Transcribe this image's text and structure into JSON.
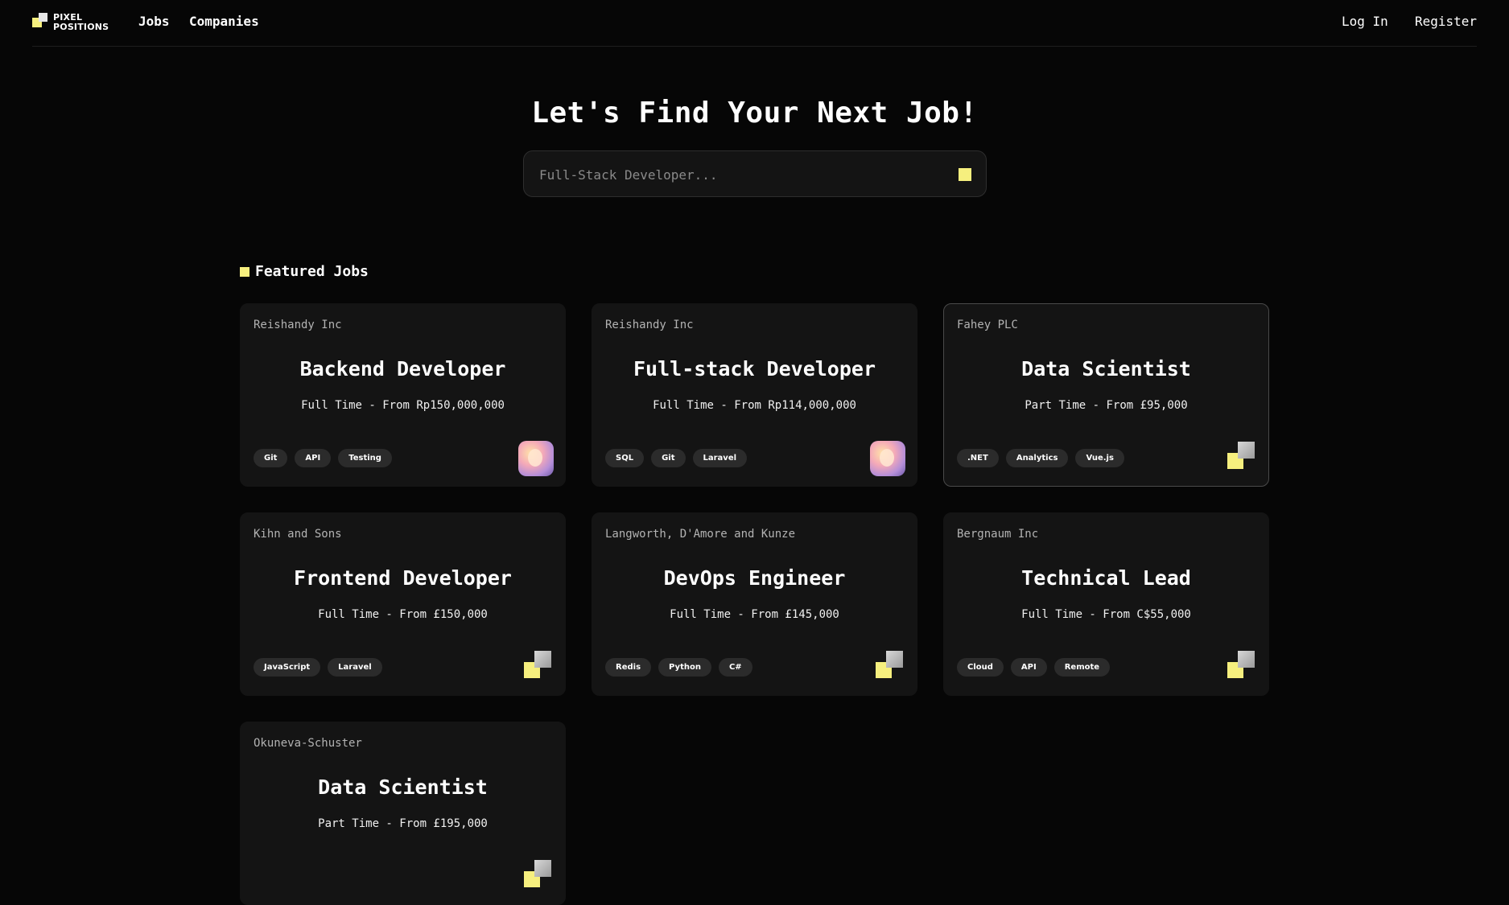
{
  "brand": {
    "logo_text": "PIXEL\nPOSITIONS"
  },
  "nav": {
    "links": [
      {
        "label": "Jobs"
      },
      {
        "label": "Companies"
      }
    ],
    "log_in": "Log In",
    "register": "Register"
  },
  "hero": {
    "title": "Let's Find Your Next Job!",
    "search_placeholder": "Full-Stack Developer..."
  },
  "featured": {
    "title": "Featured Jobs",
    "jobs": [
      {
        "company": "Reishandy Inc",
        "title": "Backend Developer",
        "meta": "Full Time - From Rp150,000,000",
        "tags": [
          "Git",
          "API",
          "Testing"
        ],
        "logo": "avatar"
      },
      {
        "company": "Reishandy Inc",
        "title": "Full-stack Developer",
        "meta": "Full Time - From Rp114,000,000",
        "tags": [
          "SQL",
          "Git",
          "Laravel"
        ],
        "logo": "avatar"
      },
      {
        "company": "Fahey PLC",
        "title": "Data Scientist",
        "meta": "Part Time - From £95,000",
        "tags": [
          ".NET",
          "Analytics",
          "Vue.js"
        ],
        "logo": "pixel-logo"
      },
      {
        "company": "Kihn and Sons",
        "title": "Frontend Developer",
        "meta": "Full Time - From £150,000",
        "tags": [
          "JavaScript",
          "Laravel"
        ],
        "logo": "pixel-logo"
      },
      {
        "company": "Langworth, D'Amore and Kunze",
        "title": "DevOps Engineer",
        "meta": "Full Time - From £145,000",
        "tags": [
          "Redis",
          "Python",
          "C#"
        ],
        "logo": "pixel-logo"
      },
      {
        "company": "Bergnaum Inc",
        "title": "Technical Lead",
        "meta": "Full Time - From C$55,000",
        "tags": [
          "Cloud",
          "API",
          "Remote"
        ],
        "logo": "pixel-logo"
      },
      {
        "company": "Okuneva-Schuster",
        "title": "Data Scientist",
        "meta": "Part Time - From £195,000",
        "tags": [],
        "logo": "pixel-logo"
      }
    ]
  },
  "colors": {
    "accent": "#f6ef7e",
    "background": "#060606",
    "card": "#141414",
    "tag": "#2b2b2b"
  }
}
